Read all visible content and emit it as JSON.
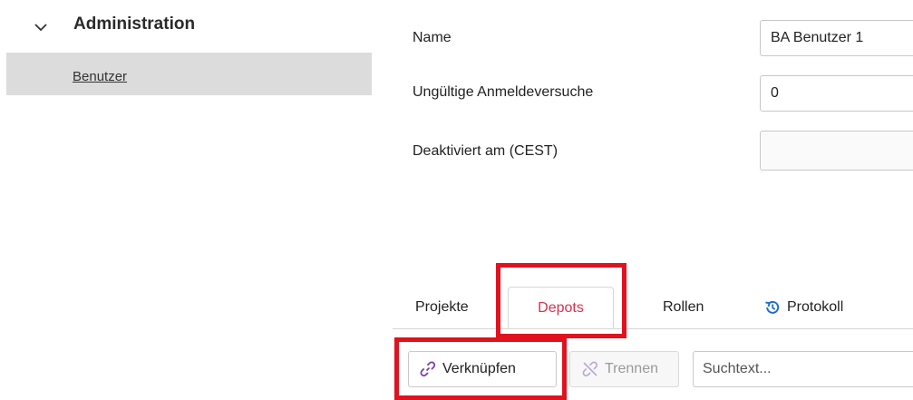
{
  "sidebar": {
    "group_label": "Administration",
    "item_label": "Benutzer"
  },
  "form": {
    "name_label": "Name",
    "name_value": "BA Benutzer 1",
    "attempts_label": "Ungültige Anmeldeversuche",
    "attempts_value": "0",
    "deactivated_label": "Deaktiviert am (CEST)",
    "deactivated_value": ""
  },
  "tabs": [
    {
      "label": "Projekte"
    },
    {
      "label": "Depots"
    },
    {
      "label": "Rollen"
    },
    {
      "label": "Protokoll"
    }
  ],
  "toolbar": {
    "link_label": "Verknüpfen",
    "unlink_label": "Trennen",
    "search_placeholder": "Suchtext..."
  },
  "colors": {
    "active_tab": "#d9304e",
    "highlight": "#e0121f",
    "link_icon": "#7b3fb5",
    "history_icon": "#1e6fd0",
    "sidebar_selected": "#dcdcdc"
  }
}
